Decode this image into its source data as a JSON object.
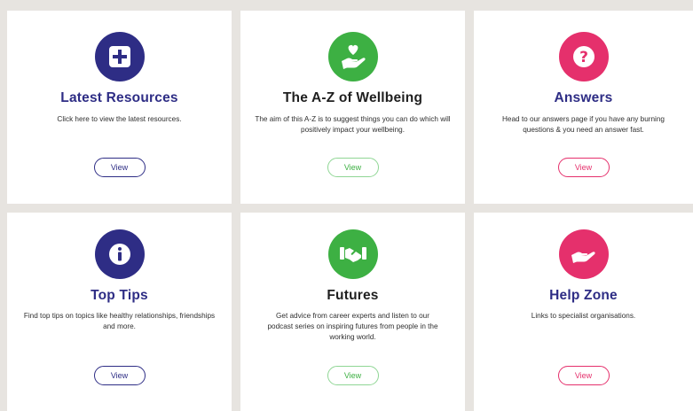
{
  "cards": [
    {
      "title": "Latest Resources",
      "description": "Click here to view the latest resources.",
      "button": "View",
      "icon": "plus-icon",
      "color": "#2e2d85"
    },
    {
      "title": "The A-Z of Wellbeing",
      "description": "The aim of this A-Z is to suggest things you can do which will positively impact your wellbeing.",
      "button": "View",
      "icon": "hand-heart-icon",
      "color": "#3db043"
    },
    {
      "title": "Answers",
      "description": "Head to our answers page if you have any burning questions & you need an answer fast.",
      "button": "View",
      "icon": "question-icon",
      "color": "#e5306c"
    },
    {
      "title": "Top Tips",
      "description": "Find top tips on topics like healthy relationships, friendships and more.",
      "button": "View",
      "icon": "info-icon",
      "color": "#2e2d85"
    },
    {
      "title": "Futures",
      "description": "Get advice from career experts and listen to our podcast series on inspiring futures from people in the working world.",
      "button": "View",
      "icon": "handshake-icon",
      "color": "#3db043"
    },
    {
      "title": "Help Zone",
      "description": "Links to specialist organisations.",
      "button": "View",
      "icon": "open-hand-icon",
      "color": "#e5306c"
    }
  ]
}
